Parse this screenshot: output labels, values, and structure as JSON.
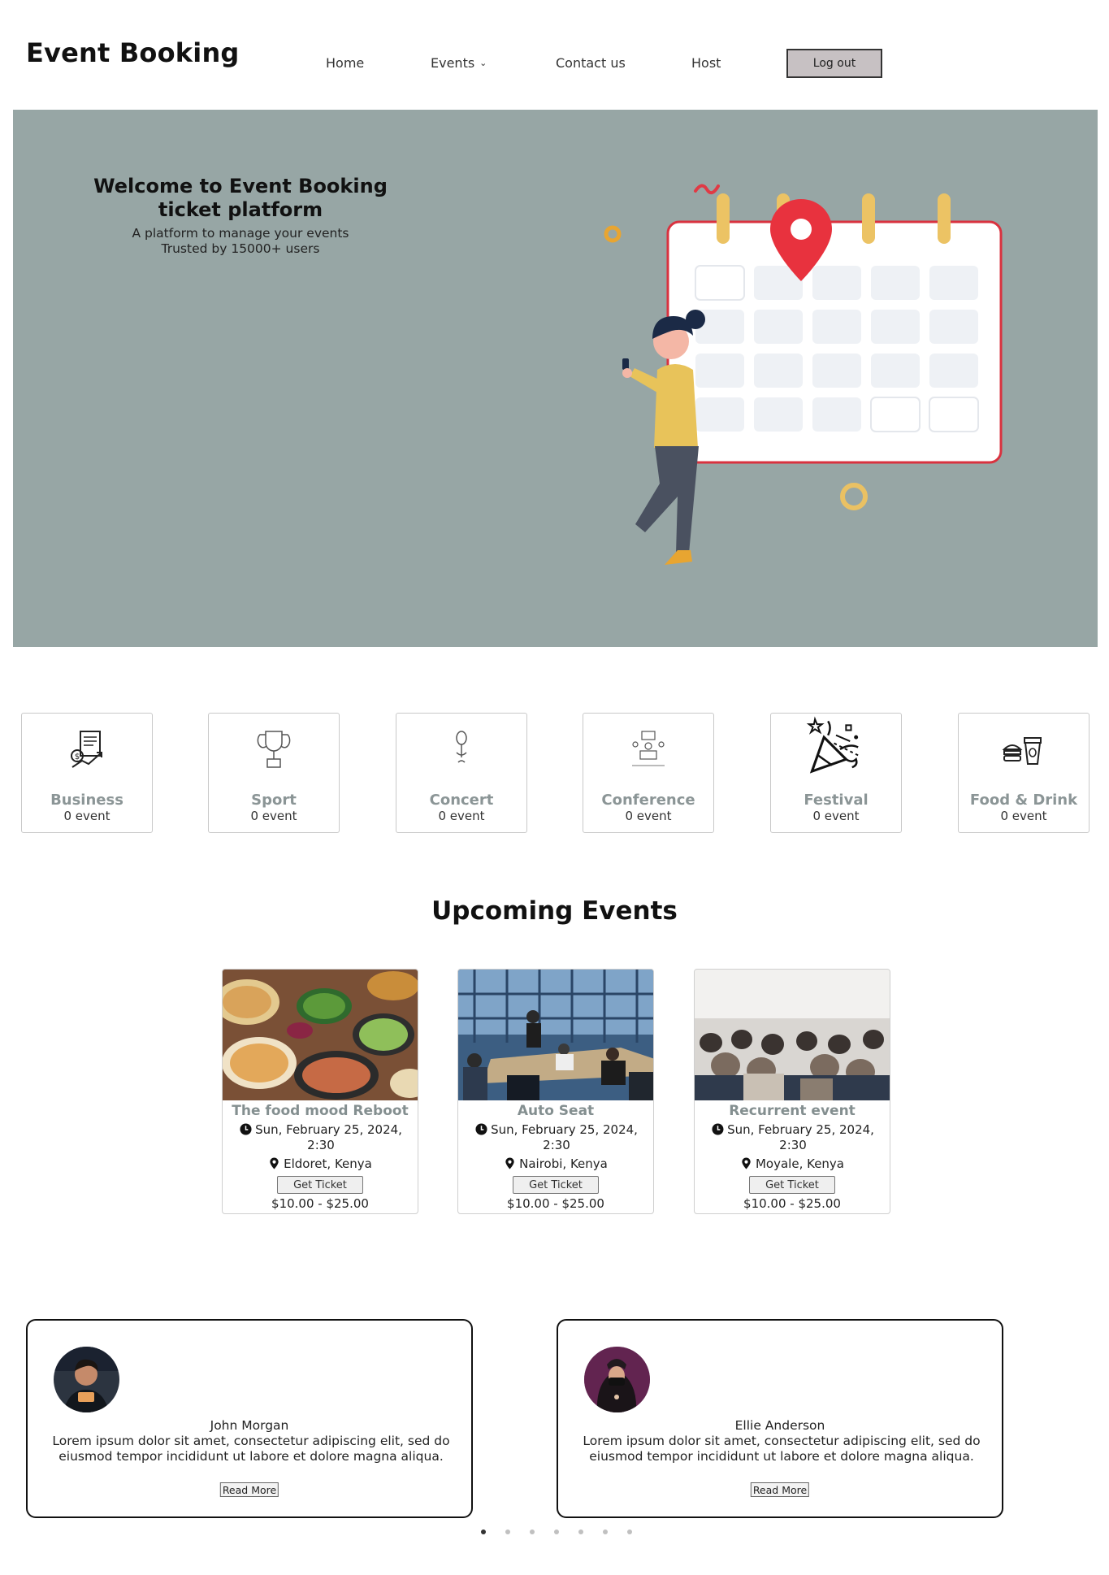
{
  "header": {
    "brand": "Event Booking",
    "nav": [
      {
        "label": "Home"
      },
      {
        "label": "Events"
      },
      {
        "label": "Contact us"
      },
      {
        "label": "Host"
      }
    ],
    "logout_label": "Log out"
  },
  "hero": {
    "title": "Welcome to Event Booking ticket platform",
    "subtitle_line1": "A platform to manage your events",
    "subtitle_line2": "Trusted by 15000+ users",
    "background_color": "#97a6a5"
  },
  "categories": [
    {
      "name": "Business",
      "count": "0 event",
      "icon": "business-icon"
    },
    {
      "name": "Sport",
      "count": "0 event",
      "icon": "trophy-icon"
    },
    {
      "name": "Concert",
      "count": "0 event",
      "icon": "microphone-icon"
    },
    {
      "name": "Conference",
      "count": "0 event",
      "icon": "conference-icon"
    },
    {
      "name": "Festival",
      "count": "0 event",
      "icon": "party-popper-icon"
    },
    {
      "name": "Food & Drink",
      "count": "0 event",
      "icon": "food-drink-icon"
    }
  ],
  "upcoming": {
    "title": "Upcoming Events",
    "events": [
      {
        "title": "The food mood Reboot",
        "date": "Sun, February 25, 2024, 2:30",
        "location": "Eldoret, Kenya",
        "button": "Get Ticket",
        "price": "$10.00 - $25.00"
      },
      {
        "title": "Auto Seat",
        "date": "Sun, February 25, 2024, 2:30",
        "location": "Nairobi, Kenya",
        "button": "Get Ticket",
        "price": "$10.00 - $25.00"
      },
      {
        "title": "Recurrent event",
        "date": "Sun, February 25, 2024, 2:30",
        "location": "Moyale, Kenya",
        "button": "Get Ticket",
        "price": "$10.00 - $25.00"
      }
    ]
  },
  "testimonials": [
    {
      "name": "John Morgan",
      "text": "Lorem ipsum dolor sit amet, consectetur adipiscing elit, sed do eiusmod tempor incididunt ut labore et dolore magna aliqua.",
      "button": "Read More"
    },
    {
      "name": "Ellie Anderson",
      "text": "Lorem ipsum dolor sit amet, consectetur adipiscing elit, sed do eiusmod tempor incididunt ut labore et dolore magna aliqua.",
      "button": "Read More"
    }
  ],
  "carousel": {
    "total_dots": 7,
    "active_index": 0
  }
}
